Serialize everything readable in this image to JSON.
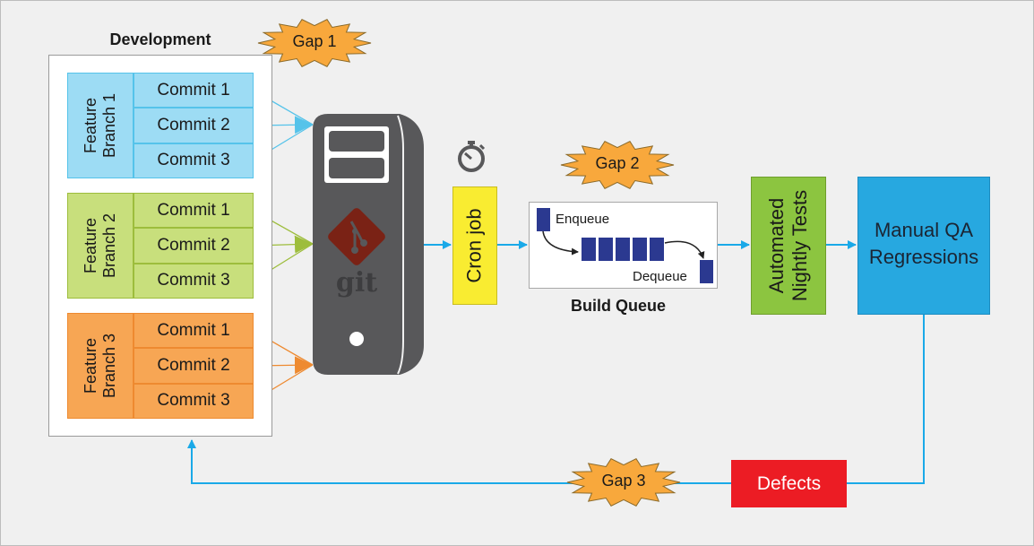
{
  "development": {
    "title": "Development",
    "branches": [
      {
        "label": "Feature\nBranch 1",
        "commits": [
          "Commit 1",
          "Commit 2",
          "Commit 3"
        ],
        "fill": "#9ddcf4",
        "stroke": "#55c3ea"
      },
      {
        "label": "Feature\nBranch 2",
        "commits": [
          "Commit 1",
          "Commit 2",
          "Commit 3"
        ],
        "fill": "#c8df7c",
        "stroke": "#9dbd3c"
      },
      {
        "label": "Feature\nBranch 3",
        "commits": [
          "Commit 1",
          "Commit 2",
          "Commit 3"
        ],
        "fill": "#f7a654",
        "stroke": "#ee8a30"
      }
    ]
  },
  "server": {
    "logo_text": "git",
    "icon": "git-server-icon",
    "color": "#58585a",
    "logo_color": "#7a2215"
  },
  "timer": {
    "icon": "stopwatch-icon"
  },
  "cron": {
    "label": "Cron job",
    "color": "#f9ec31"
  },
  "queue": {
    "title": "Build Queue",
    "enqueue": "Enqueue",
    "dequeue": "Dequeue",
    "item_color": "#2b3990"
  },
  "tests": {
    "label": "Automated\nNightly Tests",
    "color": "#8cc540"
  },
  "qa": {
    "label": "Manual QA\nRegressions",
    "color": "#27a8e0"
  },
  "defects": {
    "label": "Defects",
    "color": "#ec1c24"
  },
  "gaps": [
    "Gap 1",
    "Gap 2",
    "Gap 3"
  ],
  "colors": {
    "flow": "#1aa9e8",
    "gap": "#f8a83c"
  }
}
